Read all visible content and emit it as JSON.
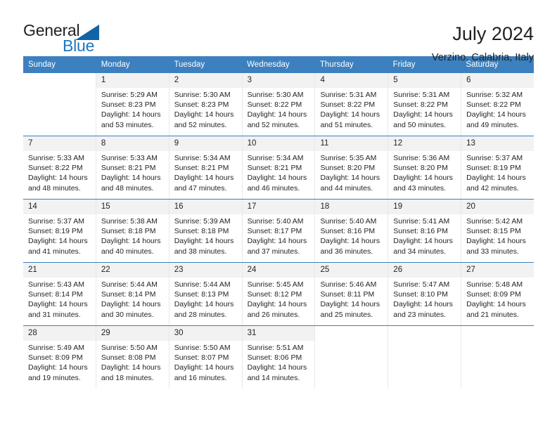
{
  "brand": {
    "name_part1": "General",
    "name_part2": "Blue",
    "triangle_color": "#1464a5",
    "blue_color": "#1c77c3"
  },
  "header": {
    "title": "July 2024",
    "location": "Verzino, Calabria, Italy"
  },
  "theme": {
    "header_bar_color": "#3c80c0",
    "day_number_band": "#f2f2f2",
    "text_color": "#231f20"
  },
  "calendar": {
    "weekdays": [
      "Sunday",
      "Monday",
      "Tuesday",
      "Wednesday",
      "Thursday",
      "Friday",
      "Saturday"
    ],
    "weeks": [
      [
        {
          "day": "",
          "lines": []
        },
        {
          "day": "1",
          "lines": [
            "Sunrise: 5:29 AM",
            "Sunset: 8:23 PM",
            "Daylight: 14 hours and 53 minutes."
          ]
        },
        {
          "day": "2",
          "lines": [
            "Sunrise: 5:30 AM",
            "Sunset: 8:23 PM",
            "Daylight: 14 hours and 52 minutes."
          ]
        },
        {
          "day": "3",
          "lines": [
            "Sunrise: 5:30 AM",
            "Sunset: 8:22 PM",
            "Daylight: 14 hours and 52 minutes."
          ]
        },
        {
          "day": "4",
          "lines": [
            "Sunrise: 5:31 AM",
            "Sunset: 8:22 PM",
            "Daylight: 14 hours and 51 minutes."
          ]
        },
        {
          "day": "5",
          "lines": [
            "Sunrise: 5:31 AM",
            "Sunset: 8:22 PM",
            "Daylight: 14 hours and 50 minutes."
          ]
        },
        {
          "day": "6",
          "lines": [
            "Sunrise: 5:32 AM",
            "Sunset: 8:22 PM",
            "Daylight: 14 hours and 49 minutes."
          ]
        }
      ],
      [
        {
          "day": "7",
          "lines": [
            "Sunrise: 5:33 AM",
            "Sunset: 8:22 PM",
            "Daylight: 14 hours and 48 minutes."
          ]
        },
        {
          "day": "8",
          "lines": [
            "Sunrise: 5:33 AM",
            "Sunset: 8:21 PM",
            "Daylight: 14 hours and 48 minutes."
          ]
        },
        {
          "day": "9",
          "lines": [
            "Sunrise: 5:34 AM",
            "Sunset: 8:21 PM",
            "Daylight: 14 hours and 47 minutes."
          ]
        },
        {
          "day": "10",
          "lines": [
            "Sunrise: 5:34 AM",
            "Sunset: 8:21 PM",
            "Daylight: 14 hours and 46 minutes."
          ]
        },
        {
          "day": "11",
          "lines": [
            "Sunrise: 5:35 AM",
            "Sunset: 8:20 PM",
            "Daylight: 14 hours and 44 minutes."
          ]
        },
        {
          "day": "12",
          "lines": [
            "Sunrise: 5:36 AM",
            "Sunset: 8:20 PM",
            "Daylight: 14 hours and 43 minutes."
          ]
        },
        {
          "day": "13",
          "lines": [
            "Sunrise: 5:37 AM",
            "Sunset: 8:19 PM",
            "Daylight: 14 hours and 42 minutes."
          ]
        }
      ],
      [
        {
          "day": "14",
          "lines": [
            "Sunrise: 5:37 AM",
            "Sunset: 8:19 PM",
            "Daylight: 14 hours and 41 minutes."
          ]
        },
        {
          "day": "15",
          "lines": [
            "Sunrise: 5:38 AM",
            "Sunset: 8:18 PM",
            "Daylight: 14 hours and 40 minutes."
          ]
        },
        {
          "day": "16",
          "lines": [
            "Sunrise: 5:39 AM",
            "Sunset: 8:18 PM",
            "Daylight: 14 hours and 38 minutes."
          ]
        },
        {
          "day": "17",
          "lines": [
            "Sunrise: 5:40 AM",
            "Sunset: 8:17 PM",
            "Daylight: 14 hours and 37 minutes."
          ]
        },
        {
          "day": "18",
          "lines": [
            "Sunrise: 5:40 AM",
            "Sunset: 8:16 PM",
            "Daylight: 14 hours and 36 minutes."
          ]
        },
        {
          "day": "19",
          "lines": [
            "Sunrise: 5:41 AM",
            "Sunset: 8:16 PM",
            "Daylight: 14 hours and 34 minutes."
          ]
        },
        {
          "day": "20",
          "lines": [
            "Sunrise: 5:42 AM",
            "Sunset: 8:15 PM",
            "Daylight: 14 hours and 33 minutes."
          ]
        }
      ],
      [
        {
          "day": "21",
          "lines": [
            "Sunrise: 5:43 AM",
            "Sunset: 8:14 PM",
            "Daylight: 14 hours and 31 minutes."
          ]
        },
        {
          "day": "22",
          "lines": [
            "Sunrise: 5:44 AM",
            "Sunset: 8:14 PM",
            "Daylight: 14 hours and 30 minutes."
          ]
        },
        {
          "day": "23",
          "lines": [
            "Sunrise: 5:44 AM",
            "Sunset: 8:13 PM",
            "Daylight: 14 hours and 28 minutes."
          ]
        },
        {
          "day": "24",
          "lines": [
            "Sunrise: 5:45 AM",
            "Sunset: 8:12 PM",
            "Daylight: 14 hours and 26 minutes."
          ]
        },
        {
          "day": "25",
          "lines": [
            "Sunrise: 5:46 AM",
            "Sunset: 8:11 PM",
            "Daylight: 14 hours and 25 minutes."
          ]
        },
        {
          "day": "26",
          "lines": [
            "Sunrise: 5:47 AM",
            "Sunset: 8:10 PM",
            "Daylight: 14 hours and 23 minutes."
          ]
        },
        {
          "day": "27",
          "lines": [
            "Sunrise: 5:48 AM",
            "Sunset: 8:09 PM",
            "Daylight: 14 hours and 21 minutes."
          ]
        }
      ],
      [
        {
          "day": "28",
          "lines": [
            "Sunrise: 5:49 AM",
            "Sunset: 8:09 PM",
            "Daylight: 14 hours and 19 minutes."
          ]
        },
        {
          "day": "29",
          "lines": [
            "Sunrise: 5:50 AM",
            "Sunset: 8:08 PM",
            "Daylight: 14 hours and 18 minutes."
          ]
        },
        {
          "day": "30",
          "lines": [
            "Sunrise: 5:50 AM",
            "Sunset: 8:07 PM",
            "Daylight: 14 hours and 16 minutes."
          ]
        },
        {
          "day": "31",
          "lines": [
            "Sunrise: 5:51 AM",
            "Sunset: 8:06 PM",
            "Daylight: 14 hours and 14 minutes."
          ]
        },
        {
          "day": "",
          "lines": []
        },
        {
          "day": "",
          "lines": []
        },
        {
          "day": "",
          "lines": []
        }
      ]
    ]
  }
}
